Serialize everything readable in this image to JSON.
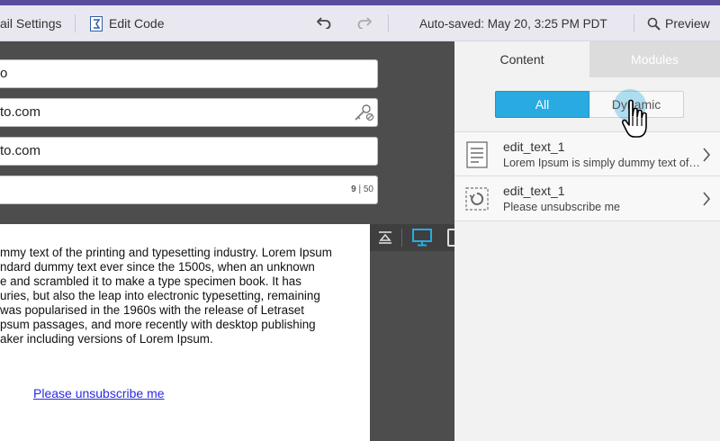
{
  "toolbar": {
    "email_settings_label": "ail Settings",
    "edit_code_label": "Edit Code",
    "autosave_text": "Auto-saved: May 20, 3:25 PM PDT",
    "preview_label": "Preview"
  },
  "fields": {
    "field1_value": "o",
    "field2_value": "to.com",
    "field3_value": "to.com",
    "counter_current": "9",
    "counter_sep": " | ",
    "counter_max": "50"
  },
  "preview": {
    "body_lines": [
      "mmy text of the printing and typesetting industry. Lorem Ipsum",
      "ndard dummy text ever since the 1500s, when an unknown",
      "e and scrambled it to make a type specimen book. It has",
      "uries, but also the leap into electronic typesetting, remaining",
      "was popularised in the 1960s with the release of Letraset",
      "psum passages, and more recently with desktop publishing",
      "aker including versions of Lorem Ipsum."
    ],
    "unsubscribe_link": "Please unsubscribe me"
  },
  "right_panel": {
    "tabs": {
      "content": "Content",
      "modules": "Modules"
    },
    "filter": {
      "all": "All",
      "dynamic": "Dynamic"
    },
    "items": [
      {
        "title": "edit_text_1",
        "subtitle": "Lorem Ipsum is simply dummy text of the printing",
        "icon": "document-icon"
      },
      {
        "title": "edit_text_1",
        "subtitle": "Please unsubscribe me",
        "icon": "dynamic-content-icon"
      }
    ]
  },
  "colors": {
    "accent_blue": "#29abe2",
    "top_accent": "#5a4e9c",
    "toolbar_bg": "#e9e8f1"
  }
}
